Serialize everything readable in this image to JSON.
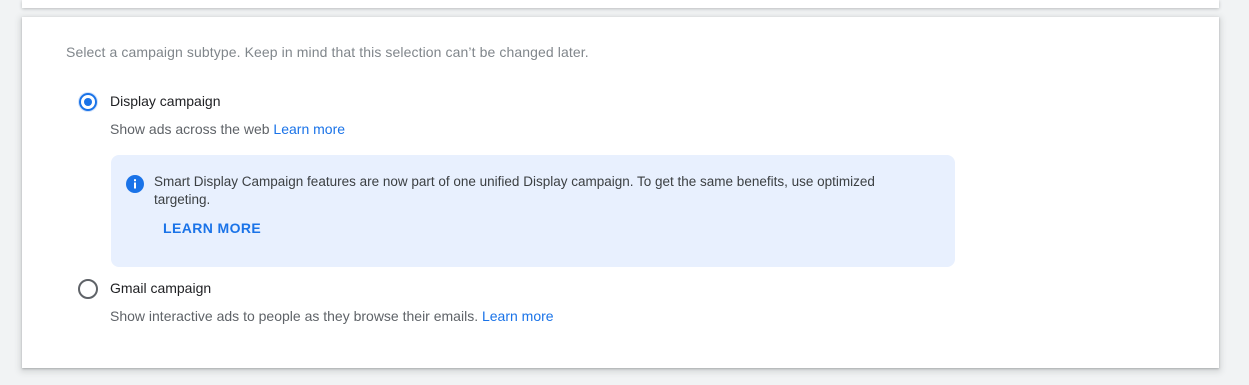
{
  "instruction": "Select a campaign subtype. Keep in mind that this selection can’t be changed later.",
  "options": [
    {
      "title": "Display campaign",
      "description": "Show ads across the web",
      "link": "Learn more",
      "selected": true
    },
    {
      "title": "Gmail campaign",
      "description": "Show interactive ads to people as they browse their emails.",
      "link": "Learn more",
      "selected": false
    }
  ],
  "info": {
    "icon": "info-icon",
    "text": "Smart Display Campaign features are now part of one unified Display campaign. To get the same benefits, use optimized targeting.",
    "button": "LEARN MORE"
  },
  "colors": {
    "accent": "#1a73e8",
    "info_background": "#e8f0fe"
  }
}
